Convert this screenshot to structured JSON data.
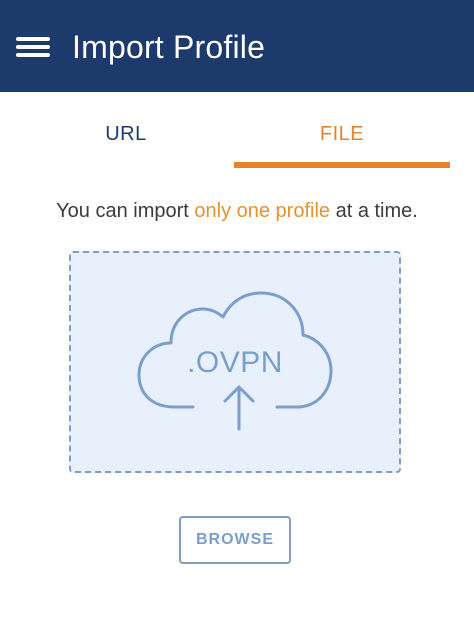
{
  "header": {
    "title": "Import Profile",
    "menu_icon": "hamburger-menu-icon"
  },
  "tabs": [
    {
      "label": "URL",
      "active": false
    },
    {
      "label": "FILE",
      "active": true
    }
  ],
  "info": {
    "prefix": "You can import ",
    "highlight": "only one profile",
    "suffix": " at a time."
  },
  "dropzone": {
    "file_type": ".OVPN",
    "icon": "cloud-upload-icon"
  },
  "browse": {
    "label": "BROWSE"
  },
  "colors": {
    "appbar": "#1c3a6b",
    "accent": "#e3832f",
    "dropzone_bg": "#e8f0fc",
    "dropzone_border": "#7f9dc7",
    "text": "#3b3b3b"
  }
}
